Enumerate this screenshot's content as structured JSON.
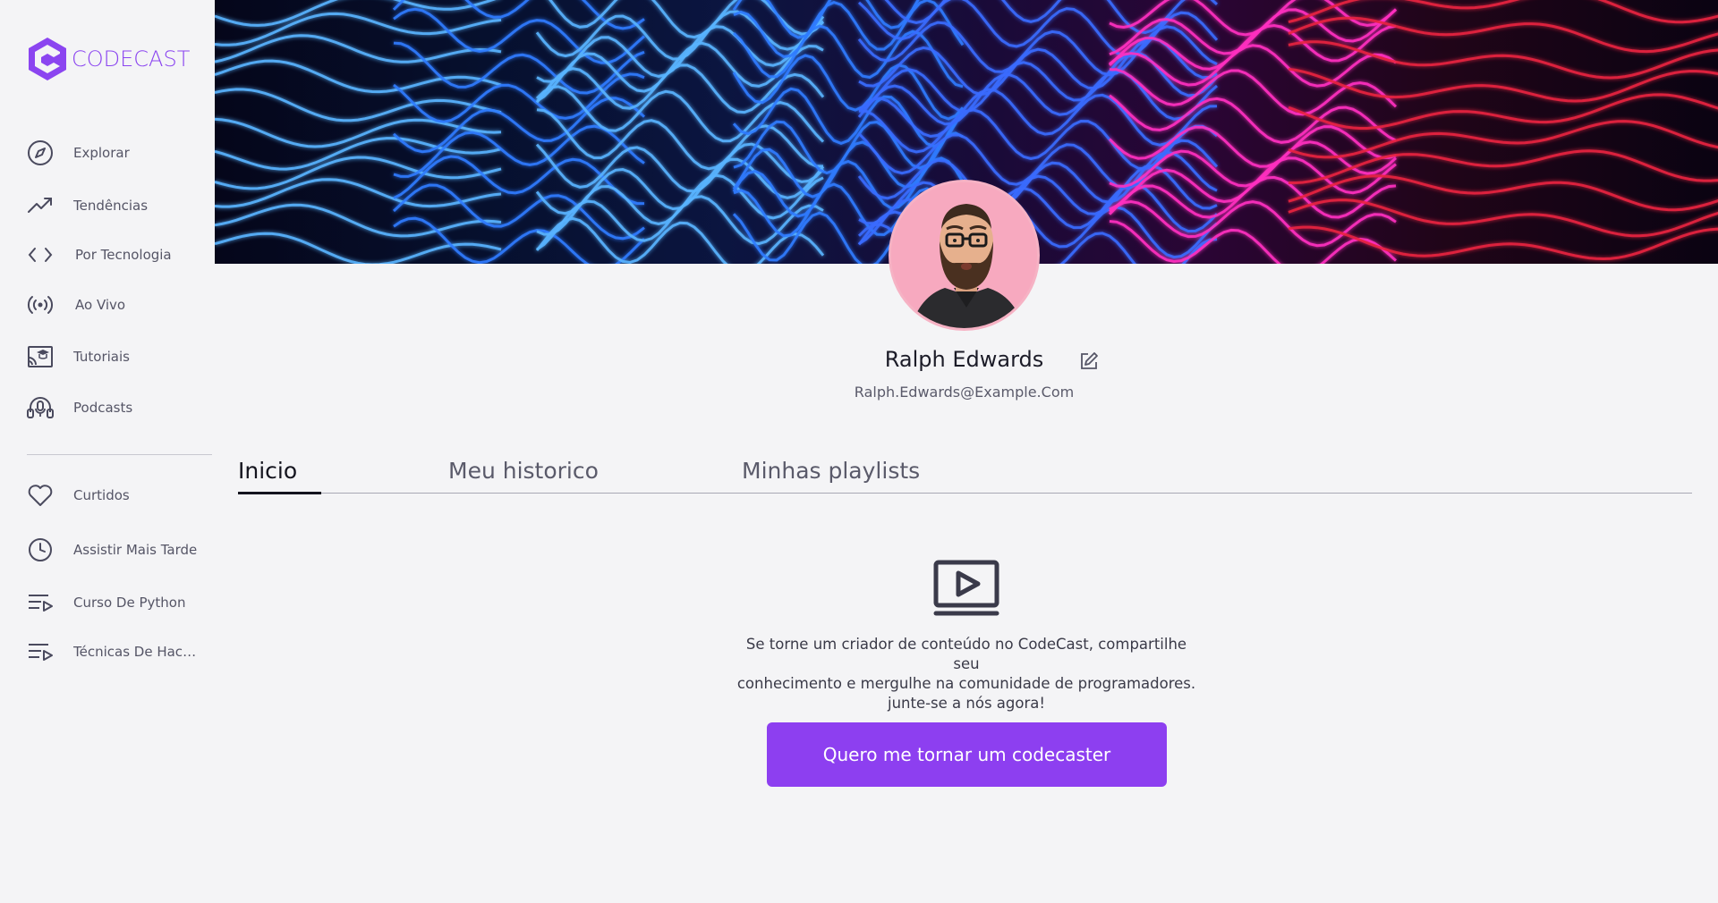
{
  "brand": {
    "name": "CODECAST",
    "accent": "#8b45f0"
  },
  "sidebar": {
    "items": [
      {
        "label": "Explorar",
        "icon": "compass-icon"
      },
      {
        "label": "Tendências",
        "icon": "trending-up-icon"
      },
      {
        "label": "Por Tecnologia",
        "icon": "code-icon"
      },
      {
        "label": "Ao Vivo",
        "icon": "broadcast-icon"
      },
      {
        "label": "Tutoriais",
        "icon": "tutorials-icon"
      },
      {
        "label": "Podcasts",
        "icon": "headphones-icon"
      }
    ],
    "library": [
      {
        "label": "Curtidos",
        "icon": "heart-icon"
      },
      {
        "label": "Assistir Mais Tarde",
        "icon": "clock-icon"
      },
      {
        "label": "Curso De Python",
        "icon": "playlist-icon"
      },
      {
        "label": "Técnicas De Hackin...",
        "icon": "playlist-icon"
      }
    ]
  },
  "profile": {
    "name": "Ralph Edwards",
    "email": "Ralph.Edwards@Example.Com"
  },
  "tabs": [
    {
      "label": "Inicio",
      "active": true
    },
    {
      "label": "Meu historico",
      "active": false
    },
    {
      "label": "Minhas playlists",
      "active": false
    }
  ],
  "empty_state": {
    "icon": "video-play-icon",
    "line1": "Se torne um criador de conteúdo no CodeCast, compartilhe seu",
    "line2": "conhecimento e mergulhe na comunidade de programadores.",
    "line3": "junte-se a nós agora!",
    "cta_label": "Quero me tornar um codecaster",
    "cta_color": "#8d3ff0"
  }
}
